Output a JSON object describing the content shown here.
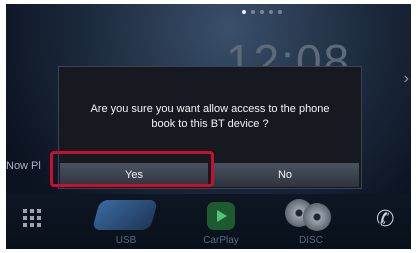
{
  "status": {
    "page_count": 5,
    "active_page": 0
  },
  "background": {
    "clock": "12:08",
    "now_playing": "Now Pl"
  },
  "dialog": {
    "message": "Are you sure you want allow access to the phone\nbook to this BT device ?",
    "yes_label": "Yes",
    "no_label": "No",
    "highlighted_button": "yes"
  },
  "dock": {
    "items": [
      {
        "icon": "apps-grid-icon",
        "label": ""
      },
      {
        "icon": "usb-icon",
        "label": "USB"
      },
      {
        "icon": "carplay-icon",
        "label": "CarPlay"
      },
      {
        "icon": "disc-icon",
        "label": "DISC"
      },
      {
        "icon": "phone-icon",
        "label": ""
      }
    ]
  },
  "colors": {
    "highlight": "#c8102e",
    "dialog_bg": "#161a20",
    "dock_label": "#5a6b82"
  }
}
